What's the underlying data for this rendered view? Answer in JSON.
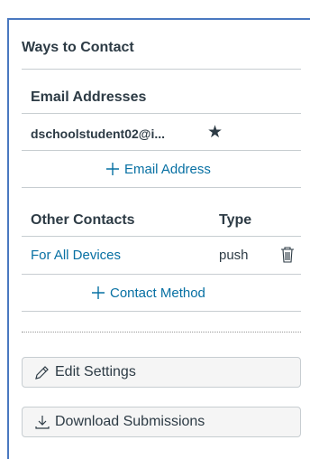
{
  "ways_to_contact": {
    "title": "Ways to Contact",
    "email_section": {
      "header": "Email Addresses",
      "email": "dschoolstudent02@i...",
      "add_label": "Email Address"
    },
    "other_section": {
      "col_contacts": "Other Contacts",
      "col_type": "Type",
      "row_label": "For All Devices",
      "row_type": "push",
      "add_label": "Contact Method"
    }
  },
  "buttons": {
    "edit_settings": "Edit Settings",
    "download_submissions": "Download Submissions"
  },
  "colors": {
    "link": "#0770a3",
    "border_accent": "#4a78c0",
    "text": "#2d3b45"
  },
  "icons": [
    "star-icon",
    "plus-icon",
    "trash-icon",
    "pencil-icon",
    "download-icon"
  ]
}
